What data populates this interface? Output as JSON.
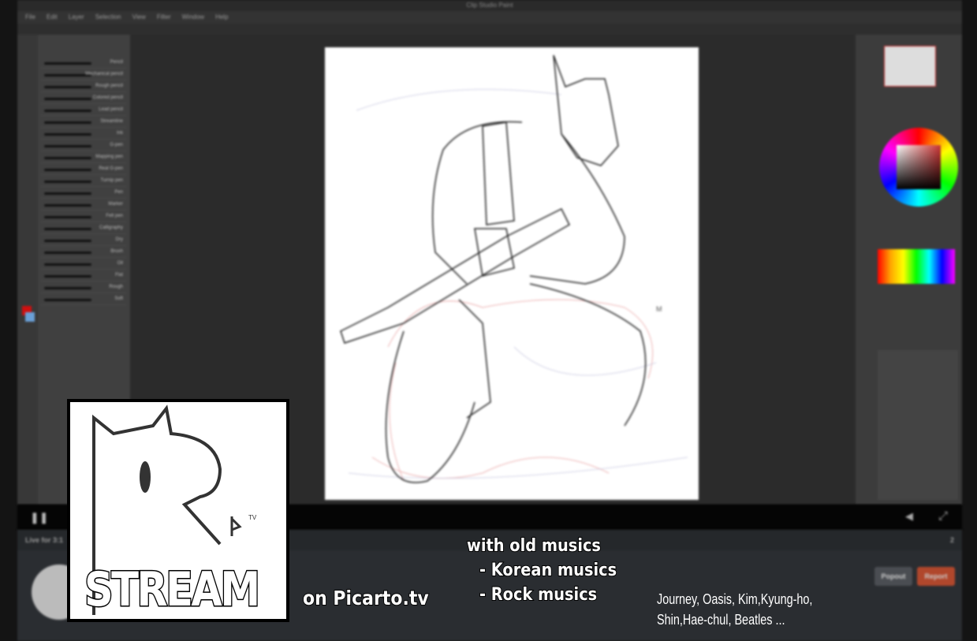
{
  "app": {
    "title": "Clip Studio Paint",
    "menu": [
      "File",
      "Edit",
      "Layer",
      "Selection",
      "View",
      "Filter",
      "Window",
      "Help"
    ],
    "brushes": [
      "Pencil",
      "Mechanical pencil",
      "Rough pencil",
      "Colored pencil",
      "Lead pencil",
      "Streamline",
      "Ink",
      "G-pen",
      "Mapping pen",
      "Real G-pen",
      "Turnip pen",
      "Pen",
      "Marker",
      "Felt pen",
      "Calligraphy",
      "Dry",
      "Brush",
      "Oil",
      "Flat",
      "Rough",
      "Soft"
    ]
  },
  "player": {
    "pause_icon": "pause-icon",
    "volume_icon": "volume-icon",
    "fullscreen_icon": "fullscreen-icon"
  },
  "info": {
    "live_label": "Live for 3:1",
    "viewers": "2",
    "popout_label": "Popout",
    "report_label": "Report",
    "report_color": "#b0472c"
  },
  "overlay": {
    "logo_small": "P",
    "logo_tv": "TV",
    "stream_label": "STREAM",
    "platform": "on Picarto.tv",
    "music_heading": "with old musics",
    "music_items": [
      "- Korean musics",
      "- Rock musics"
    ],
    "artists_line1": "Journey, Oasis, Kim,Kyung-ho,",
    "artists_line2": "Shin,Hae-chul, Beatles ..."
  }
}
